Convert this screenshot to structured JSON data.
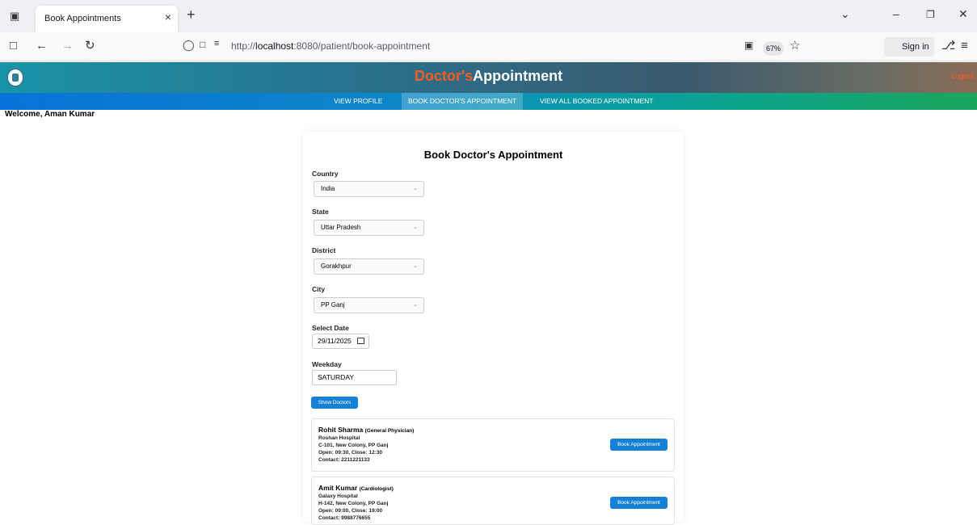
{
  "browser": {
    "tab_title": "Book Appointments",
    "tab_close": "×",
    "new_tab": "+",
    "url_prefix": "http://",
    "url_host": "localhost",
    "url_path": ":8080/patient/book-appointment",
    "zoom": "67%",
    "sign_in": "Sign in"
  },
  "header": {
    "brand_part1": "Doctor's",
    "brand_part2": "Appointment",
    "logout": "Logout"
  },
  "menu": {
    "items": [
      {
        "label": "VIEW PROFILE"
      },
      {
        "label": "BOOK DOCTOR'S APPOINTMENT"
      },
      {
        "label": "VIEW ALL BOOKED APPOINTMENT"
      }
    ],
    "active_index": 1
  },
  "welcome": "Welcome, Aman Kumar",
  "form": {
    "title": "Book Doctor's Appointment",
    "country_label": "Country",
    "country_value": "India",
    "state_label": "State",
    "state_value": "Uttar Pradesh",
    "district_label": "District",
    "district_value": "Gorakhpur",
    "city_label": "City",
    "city_value": "PP Ganj",
    "date_label": "Select Date",
    "date_value": "29/11/2025",
    "weekday_label": "Weekday",
    "weekday_value": "SATURDAY",
    "show_doctors": "Show Doctors"
  },
  "doctors": [
    {
      "name": "Rohit Sharma",
      "specialty": "(General Physician)",
      "hospital": "Roshan Hospital",
      "address": "C-101, New Colony, PP Ganj",
      "hours": "Open: 09:30, Close: 12:30",
      "contact": "Contact: 2211221133",
      "button": "Book Appointment"
    },
    {
      "name": "Amit Kumar",
      "specialty": "(Cardiologist)",
      "hospital": "Galaxy Hospital",
      "address": "H-142, New Colony, PP Ganj",
      "hours": "Open: 09:00, Close: 19:00",
      "contact": "Contact: 9988776655",
      "button": "Book Appointment"
    }
  ],
  "colors": {
    "brand_orange": "#ff5a1f",
    "button_blue": "#1581d6"
  }
}
